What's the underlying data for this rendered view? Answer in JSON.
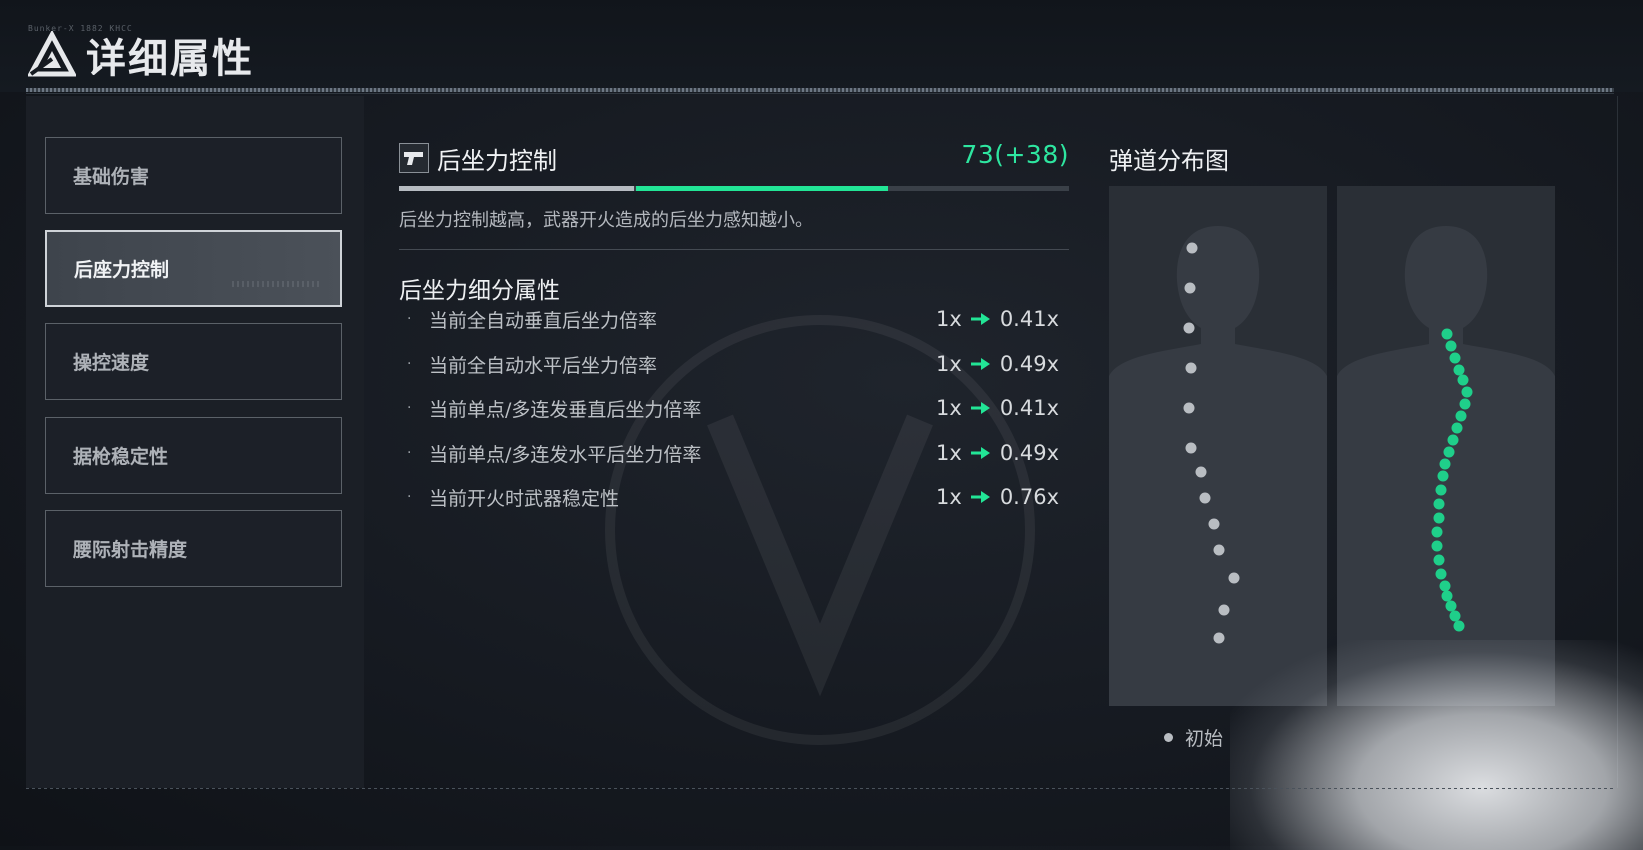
{
  "header": {
    "title": "详细属性",
    "tiny_code": "Bunker-X 1882 KHCC"
  },
  "nav": {
    "items": [
      {
        "label": "基础伤害",
        "active": false
      },
      {
        "label": "后座力控制",
        "active": true
      },
      {
        "label": "操控速度",
        "active": false
      },
      {
        "label": "据枪稳定性",
        "active": false
      },
      {
        "label": "腰际射击精度",
        "active": false
      }
    ]
  },
  "stat": {
    "icon": "pistol-icon",
    "name": "后坐力控制",
    "value_text": "73(+38)",
    "base_value": 35,
    "bonus_value": 38,
    "max_value": 100,
    "description": "后坐力控制越高，武器开火造成的后坐力感知越小。",
    "sub_title": "后坐力细分属性",
    "attributes": [
      {
        "label": "当前全自动垂直后坐力倍率",
        "from": "1x",
        "to": "0.41x"
      },
      {
        "label": "当前全自动水平后坐力倍率",
        "from": "1x",
        "to": "0.49x"
      },
      {
        "label": "当前单点/多连发垂直后坐力倍率",
        "from": "1x",
        "to": "0.41x"
      },
      {
        "label": "当前单点/多连发水平后坐力倍率",
        "from": "1x",
        "to": "0.49x"
      },
      {
        "label": "当前开火时武器稳定性",
        "from": "1x",
        "to": "0.76x"
      }
    ]
  },
  "trajectory": {
    "title": "弹道分布图",
    "legend_label": "初始",
    "colors": {
      "initial": "#b9bdc2",
      "current": "#1fcf8a",
      "accent": "#2ee6a0"
    }
  }
}
